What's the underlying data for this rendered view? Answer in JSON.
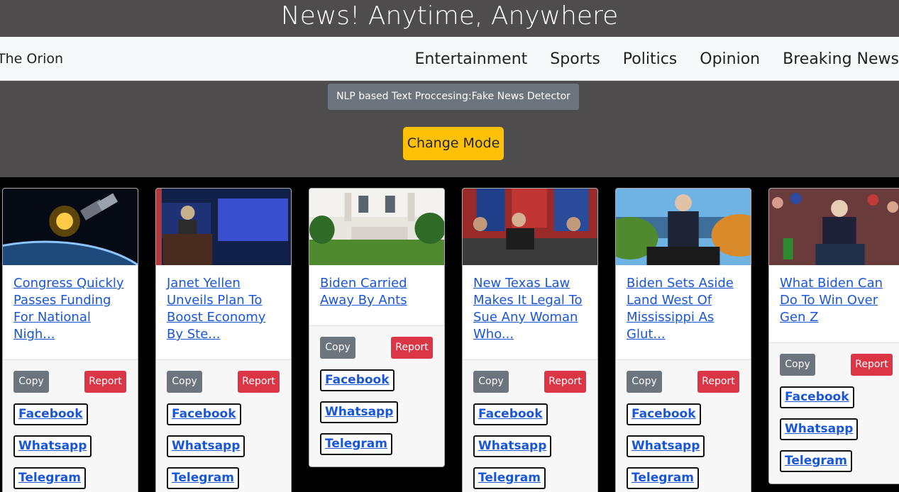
{
  "header": {
    "title": "News! Anytime, Anywhere"
  },
  "nav": {
    "brand": "The Orion",
    "links": [
      "Entertainment",
      "Sports",
      "Politics",
      "Opinion",
      "Breaking News"
    ]
  },
  "controls": {
    "nlp_label": "NLP based Text Proccesing:Fake News Detector",
    "mode_button": "Change Mode"
  },
  "card_labels": {
    "copy": "Copy",
    "report": "Report",
    "facebook": "Facebook",
    "whatsapp": "Whatsapp",
    "telegram": "Telegram"
  },
  "cards": [
    {
      "title": "Congress Quickly Passes Funding For National Nigh...",
      "image": "satellite-over-earth"
    },
    {
      "title": "Janet Yellen Unveils Plan To Boost Economy By Ste...",
      "image": "white-house-press-briefing"
    },
    {
      "title": "Biden Carried Away By Ants",
      "image": "white-house-lawn"
    },
    {
      "title": "New Texas Law Makes It Legal To Sue Any Woman Who...",
      "image": "bill-signing-flags"
    },
    {
      "title": "Biden Sets Aside Land West Of Mississippi As Glut...",
      "image": "biden-lakeside-podium"
    },
    {
      "title": "What Biden Can Do To Win Over Gen Z",
      "image": "biden-crowd-rally"
    }
  ],
  "colors": {
    "header_bg": "#4e4c4d",
    "accent_yellow": "#ffc107",
    "report_red": "#dc3545",
    "link_blue": "#1a56d6"
  }
}
